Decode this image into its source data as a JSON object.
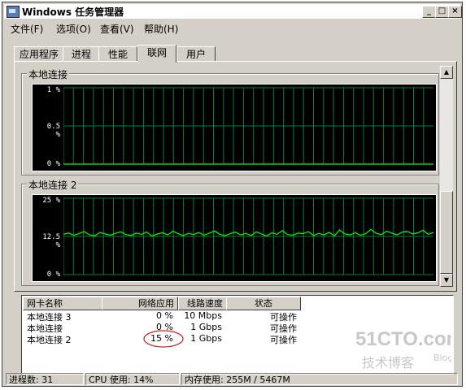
{
  "window": {
    "title": "Windows 任务管理器",
    "min_label": "_",
    "max_label": "□",
    "close_label": "×"
  },
  "menu": [
    {
      "label": "文件(F)"
    },
    {
      "label": "选项(O)"
    },
    {
      "label": "查看(V)"
    },
    {
      "label": "帮助(H)"
    }
  ],
  "tabs": [
    {
      "label": "应用程序",
      "active": false
    },
    {
      "label": "进程",
      "active": false
    },
    {
      "label": "性能",
      "active": false
    },
    {
      "label": "联网",
      "active": true
    },
    {
      "label": "用户",
      "active": false
    }
  ],
  "graphs": [
    {
      "label": "本地连接",
      "ticks": [
        "1 %",
        "0.5 %",
        "0 %"
      ],
      "max": 1,
      "chart_data": {
        "type": "line",
        "ylim": [
          0,
          1
        ],
        "values": [
          0,
          0,
          0,
          0,
          0,
          0,
          0,
          0,
          0,
          0
        ]
      }
    },
    {
      "label": "本地连接 2",
      "ticks": [
        "25 %",
        "12.5 %",
        "0 %"
      ],
      "max": 25,
      "chart_data": {
        "type": "line",
        "ylim": [
          0,
          25
        ],
        "values": [
          13.2,
          13.6,
          12.9,
          13.4,
          14.1,
          13.0,
          12.7,
          13.8,
          13.3,
          12.9,
          13.5,
          14.0,
          13.1,
          12.8,
          13.6,
          13.2,
          13.9,
          12.6,
          13.3,
          13.7,
          13.0,
          14.2,
          13.4,
          12.8,
          13.5,
          13.1,
          13.8,
          12.9,
          13.6,
          14.3,
          13.2,
          12.7,
          13.4,
          13.9,
          13.0,
          13.5,
          12.8,
          14.0,
          13.3,
          12.6,
          13.7,
          13.2,
          14.4,
          13.1,
          12.9,
          13.6,
          13.4,
          14.1,
          12.8,
          13.5,
          13.0,
          13.8,
          12.7,
          14.6,
          13.3,
          13.0,
          13.7,
          12.9,
          13.4,
          14.8,
          13.5,
          13.1,
          14.2,
          13.6,
          13.0,
          13.9,
          14.1,
          13.3,
          13.7,
          14.5,
          13.2,
          13.8
        ]
      }
    }
  ],
  "table": {
    "columns": [
      "网卡名称",
      "网络应用",
      "线路速度",
      "状态"
    ],
    "rows": [
      {
        "name": "本地连接 3",
        "usage": "0 %",
        "speed": "10 Mbps",
        "state": "可操作"
      },
      {
        "name": "本地连接",
        "usage": "0 %",
        "speed": "1 Gbps",
        "state": "可操作"
      },
      {
        "name": "本地连接 2",
        "usage": "15 %",
        "speed": "1 Gbps",
        "state": "可操作"
      }
    ]
  },
  "statusbar": {
    "processes": "进程数: 31",
    "cpu": "CPU 使用: 14%",
    "memory": "内存使用: 255M / 5467M"
  },
  "watermark": {
    "site": "51CTO.com",
    "sub": "技术博客",
    "blog": "Blog"
  },
  "colors": {
    "graph_bg": "#000000",
    "grid": "#008040",
    "line": "#00ff00",
    "annotation": "#cc2222"
  }
}
